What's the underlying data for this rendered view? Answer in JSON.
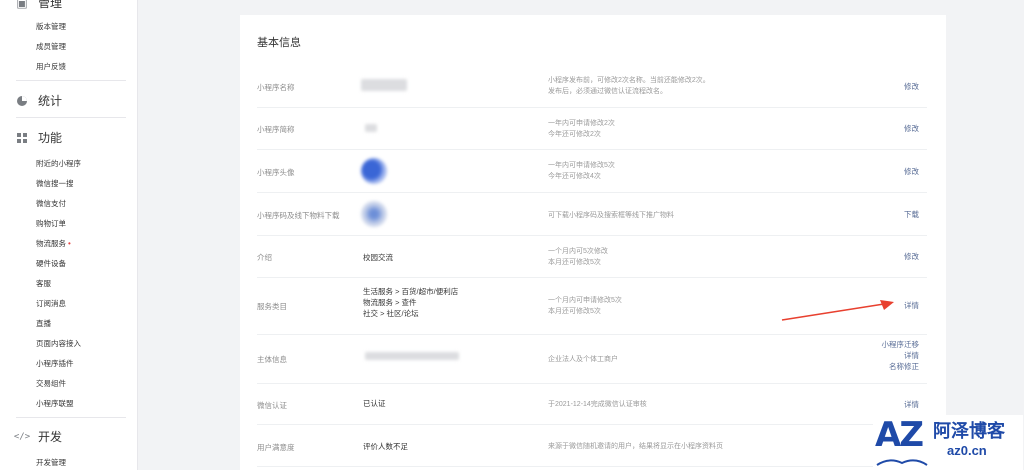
{
  "sidebar": {
    "group_manage_label": "管理",
    "manage_items": [
      "版本管理",
      "成员管理",
      "用户反馈"
    ],
    "group_stats_label": "统计",
    "group_features_label": "功能",
    "feature_items": [
      "附近的小程序",
      "微信搜一搜",
      "微信支付",
      "购物订单",
      "物流服务",
      "硬件设备",
      "客服",
      "订阅消息",
      "直播",
      "页面内容接入",
      "小程序插件",
      "交易组件",
      "小程序联盟"
    ],
    "group_dev_label": "开发",
    "dev_items": [
      "开发管理"
    ]
  },
  "card": {
    "title": "基本信息",
    "rows": {
      "name": {
        "label": "小程序名称",
        "note1": "小程序发布前，可修改2次名称。当前还能修改2次。",
        "note2": "发布后，必须通过微信认证流程改名。",
        "action": "修改"
      },
      "short_name": {
        "label": "小程序简称",
        "note1": "一年内可申请修改2次",
        "note2": "今年还可修改2次",
        "action": "修改"
      },
      "avatar": {
        "label": "小程序头像",
        "note1": "一年内可申请修改5次",
        "note2": "今年还可修改4次",
        "action": "修改"
      },
      "qrcode": {
        "label": "小程序码及线下物料下载",
        "note1": "可下载小程序码及搜索框等线下推广物料",
        "action": "下载"
      },
      "intro": {
        "label": "介绍",
        "value": "校园交流",
        "note1": "一个月内可5次修改",
        "note2": "本月还可修改5次",
        "action": "修改"
      },
      "category": {
        "label": "服务类目",
        "value1": "生活服务 > 百货/超市/便利店",
        "value2": "物流服务 > 查件",
        "value3": "社交 > 社区/论坛",
        "note1": "一个月内可申请修改5次",
        "note2": "本月还可修改5次",
        "action": "详情"
      },
      "entity": {
        "label": "主体信息",
        "note1": "企业法人及个体工商户",
        "action1": "小程序迁移",
        "action2": "详情",
        "action3": "名称修正"
      },
      "verify": {
        "label": "微信认证",
        "value": "已认证",
        "note1": "于2021-12-14完成微信认证审核",
        "action": "详情"
      },
      "rating": {
        "label": "用户满意度",
        "value": "评价人数不足",
        "note1": "来源于微信随机邀请的用户，结果将显示在小程序资料页"
      }
    }
  },
  "watermark": {
    "logo": "AZ",
    "name": "阿泽博客",
    "url": "az0.cn"
  },
  "colors": {
    "link": "#576b95",
    "annotation_arrow": "#e8402f",
    "brand": "#1f4aa8"
  }
}
